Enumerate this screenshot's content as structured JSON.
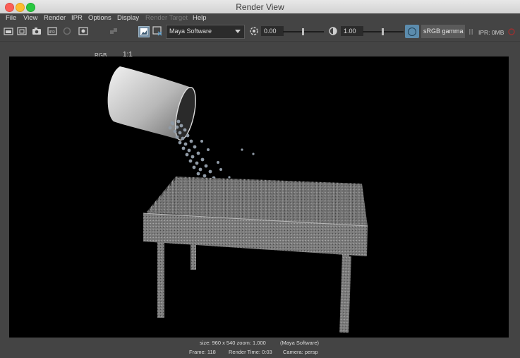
{
  "window": {
    "title": "Render View"
  },
  "menu": {
    "items": [
      "File",
      "View",
      "Render",
      "IPR",
      "Options",
      "Display",
      "Render Target",
      "Help"
    ]
  },
  "toolbar": {
    "rgb_label": "RGB",
    "ratio_label": "1:1",
    "renderer": "Maya Software",
    "exposure_value": "0.00",
    "gamma_value": "1.00",
    "colorspace": "sRGB gamma",
    "ipr_status": "IPR: 0MB"
  },
  "status": {
    "line1_size": "size: 960 x 540 zoom: 1.000",
    "line1_renderer": "(Maya Software)",
    "frame": "Frame: 118",
    "render_time": "Render Time: 0:03",
    "camera": "Camera: persp"
  },
  "icons": [
    "render-frame-icon",
    "render-region-icon",
    "snapshot-icon",
    "ipr-render-icon",
    "refresh-icon",
    "render-settings-icon",
    "rgb-channel-icon",
    "swap-icon",
    "frame-region-icon",
    "image-overlay-icon",
    "exposure-icon",
    "gamma-icon",
    "color-management-icon",
    "close-icon"
  ]
}
